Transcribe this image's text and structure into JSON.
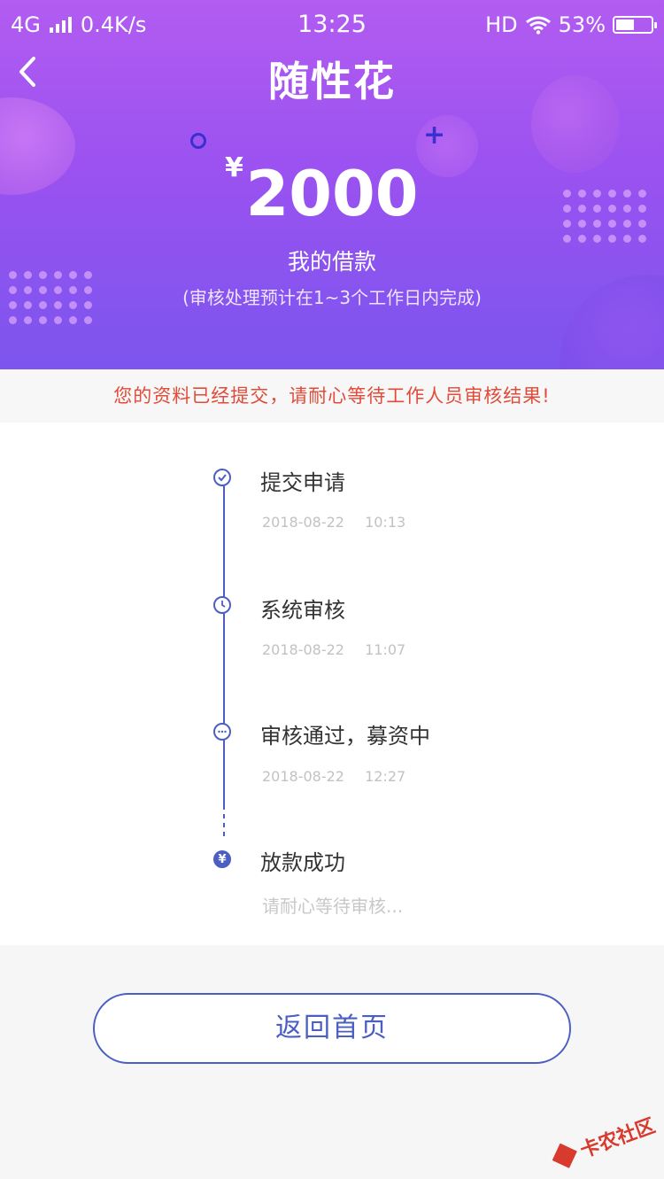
{
  "status_bar": {
    "network": "4G",
    "speed": "0.4K/s",
    "time": "13:25",
    "hd": "HD",
    "battery": "53%",
    "battery_level": 0.53
  },
  "header": {
    "title": "随性花",
    "currency": "¥",
    "amount": "2000",
    "amount_label": "我的借款",
    "note": "(审核处理预计在1~3个工作日内完成)"
  },
  "notice": "您的资料已经提交，请耐心等待工作人员审核结果!",
  "timeline": {
    "steps": [
      {
        "title": "提交申请",
        "time": "2018-08-22 10:13",
        "icon": "check-circle-icon"
      },
      {
        "title": "系统审核",
        "time": "2018-08-22 11:07",
        "icon": "clock-icon"
      },
      {
        "title": "审核通过，募资中",
        "time": "2018-08-22 12:27",
        "icon": "ellipsis-circle-icon"
      },
      {
        "title": "放款成功",
        "pending": "请耐心等待审核...",
        "icon": "yen-circle-icon",
        "node_glyph": "¥"
      }
    ]
  },
  "button": {
    "label": "返回首页"
  },
  "watermark": {
    "text": "卡农社区"
  },
  "colors": {
    "accent": "#4b5fc2",
    "notice": "#e04b3a",
    "header_top": "#b25cf1",
    "header_bottom": "#7c55ee"
  }
}
